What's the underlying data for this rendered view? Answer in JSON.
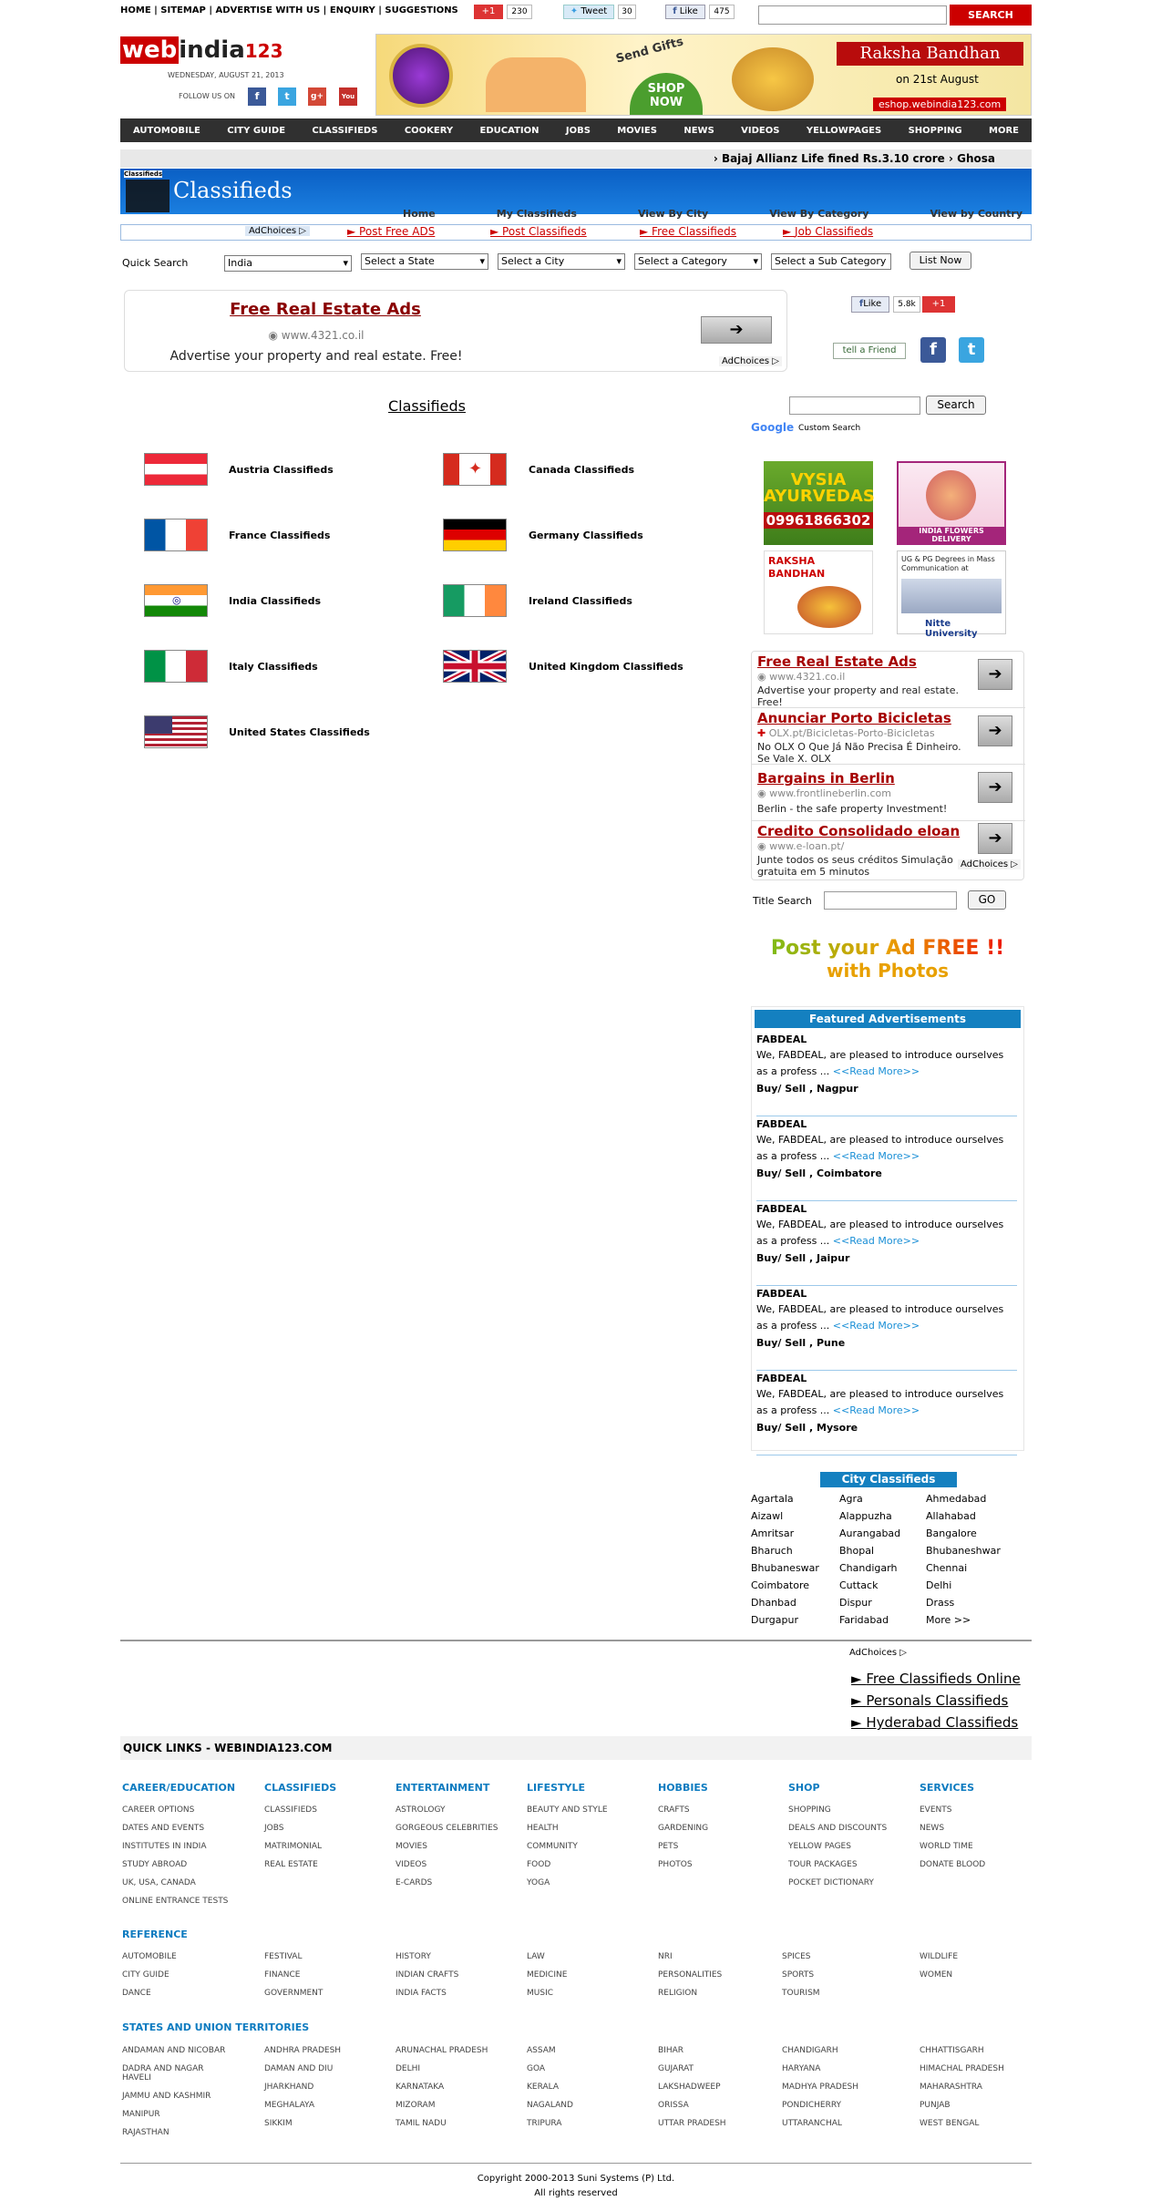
{
  "top": {
    "links": [
      "HOME",
      "SITEMAP",
      "ADVERTISE WITH US",
      "ENQUIRY",
      "SUGGESTIONS"
    ],
    "gplus_label": "+1",
    "gplus_count": "230",
    "tweet_label": "Tweet",
    "tweet_count": "30",
    "fb_label": "Like",
    "fb_count": "475",
    "search_button": "SEARCH",
    "search_value": ""
  },
  "brand": {
    "logo_web": "web",
    "logo_india": "india",
    "logo_num": "123",
    "date": "WEDNESDAY, AUGUST 21, 2013",
    "follow": "FOLLOW US ON"
  },
  "banner": {
    "send_gifts": "Send Gifts",
    "shop_now": "SHOP NOW",
    "title": "Raksha Bandhan",
    "date": "on 21st August",
    "url": "eshop.webindia123.com"
  },
  "nav": [
    "AUTOMOBILE",
    "CITY GUIDE",
    "CLASSIFIEDS",
    "COOKERY",
    "EDUCATION",
    "JOBS",
    "MOVIES",
    "NEWS",
    "VIDEOS",
    "YELLOWPAGES",
    "SHOPPING",
    "MORE"
  ],
  "ticker": "Bajaj Allianz Life fined Rs.3.10 crore  ›  Ghosa",
  "classifieds_banner": {
    "small": "Classifieds",
    "big": "Classifieds"
  },
  "subnav": [
    "Home",
    "My Classifieds",
    "View By City",
    "View By Category",
    "View by Country"
  ],
  "adlinks": {
    "adchoices": "AdChoices",
    "items": [
      "Post Free ADS",
      "Post Classifieds",
      "Free Classifieds",
      "Job Classifieds"
    ]
  },
  "quick_search": {
    "label": "Quick Search",
    "country": "India",
    "state": "Select a State",
    "city": "Select a City",
    "category": "Select a Category",
    "subcategory": "Select a Sub Category",
    "button": "List Now"
  },
  "top_ad": {
    "title": "Free Real Estate Ads",
    "url": "www.4321.co.il",
    "desc": "Advertise your property and real estate. Free!",
    "adchoices": "AdChoices"
  },
  "social": {
    "fb_like": "Like",
    "fb_count": "5.8k",
    "gplus": "+1",
    "tell": "tell a Friend"
  },
  "main_title": "Classifieds",
  "countries": [
    {
      "name": "Austria Classifieds"
    },
    {
      "name": "Canada Classifieds"
    },
    {
      "name": "France Classifieds"
    },
    {
      "name": "Germany Classifieds"
    },
    {
      "name": "India Classifieds"
    },
    {
      "name": "Ireland Classifieds"
    },
    {
      "name": "Italy Classifieds"
    },
    {
      "name": "United Kingdom Classifieds"
    },
    {
      "name": "United States Classifieds"
    }
  ],
  "google_search": {
    "button": "Search",
    "custom": "Custom Search",
    "google": "Google"
  },
  "side_ads": {
    "vysia": "VYSIA AYURVEDAS",
    "vysia_phone": "09961866302",
    "flowers": "INDIA FLOWERS DELIVERY",
    "raksha": "RAKSHA BANDHAN",
    "nitte_text": "UG & PG Degrees in Mass Communication at",
    "nitte": "Nitte University"
  },
  "text_ads": [
    {
      "title": "Free Real Estate Ads",
      "url": "www.4321.co.il",
      "desc": "Advertise your property and real estate. Free!"
    },
    {
      "title": "Anunciar Porto Bicicletas",
      "url": "OLX.pt/Bicicletas-Porto-Bicicletas",
      "desc": "No OLX O Que Já Não Precisa É Dinheiro. Se Vale X. OLX"
    },
    {
      "title": "Bargains in Berlin",
      "url": "www.frontlineberlin.com",
      "desc": "Berlin - the safe property Investment!"
    },
    {
      "title": "Credito Consolidado eloan",
      "url": "www.e-loan.pt/",
      "desc": "Junte todos os seus créditos Simulação gratuita em 5 minutos"
    }
  ],
  "text_ads_adchoices": "AdChoices",
  "title_search": {
    "label": "Title Search",
    "button": "GO"
  },
  "post_ad": {
    "line1": "Post your Ad FREE !!",
    "line2": "with Photos"
  },
  "featured": {
    "header": "Featured Advertisements",
    "items": [
      {
        "title": "FABDEAL",
        "text": "We, FABDEAL, are pleased to introduce ourselves as a profess ...",
        "more": "<<Read More>>",
        "loc": "Buy/ Sell , Nagpur"
      },
      {
        "title": "FABDEAL",
        "text": "We, FABDEAL, are pleased to introduce ourselves as a profess ...",
        "more": "<<Read More>>",
        "loc": "Buy/ Sell , Coimbatore"
      },
      {
        "title": "FABDEAL",
        "text": "We, FABDEAL, are pleased to introduce ourselves as a profess ...",
        "more": "<<Read More>>",
        "loc": "Buy/ Sell , Jaipur"
      },
      {
        "title": "FABDEAL",
        "text": "We, FABDEAL, are pleased to introduce ourselves as a profess ...",
        "more": "<<Read More>>",
        "loc": "Buy/ Sell , Pune"
      },
      {
        "title": "FABDEAL",
        "text": "We, FABDEAL, are pleased to introduce ourselves as a profess ...",
        "more": "<<Read More>>",
        "loc": "Buy/ Sell , Mysore"
      }
    ]
  },
  "city_classifieds": {
    "header": "City Classifieds",
    "cities": [
      "Agartala",
      "Agra",
      "Ahmedabad",
      "Aizawl",
      "Alappuzha",
      "Allahabad",
      "Amritsar",
      "Aurangabad",
      "Bangalore",
      "Bharuch",
      "Bhopal",
      "Bhubaneshwar",
      "Bhubaneswar",
      "Chandigarh",
      "Chennai",
      "Coimbatore",
      "Cuttack",
      "Delhi",
      "Dhanbad",
      "Dispur",
      "Drass",
      "Durgapur",
      "Faridabad",
      "More >>"
    ]
  },
  "bottom_ads": {
    "adchoices": "AdChoices",
    "items": [
      "Free Classifieds Online",
      "Personals Classifieds",
      "Hyderabad Classifieds"
    ]
  },
  "quicklinks": {
    "title": "QUICK LINKS - WEBINDIA123.COM",
    "cols": [
      {
        "h": "CAREER/EDUCATION",
        "items": [
          "CAREER OPTIONS",
          "DATES AND EVENTS",
          "INSTITUTES IN INDIA",
          "STUDY ABROAD",
          "UK, USA, CANADA",
          "ONLINE ENTRANCE TESTS"
        ]
      },
      {
        "h": "CLASSIFIEDS",
        "items": [
          "CLASSIFIEDS",
          "JOBS",
          "MATRIMONIAL",
          "REAL ESTATE"
        ]
      },
      {
        "h": "ENTERTAINMENT",
        "items": [
          "ASTROLOGY",
          "GORGEOUS CELEBRITIES",
          "MOVIES",
          "VIDEOS",
          "E-CARDS"
        ]
      },
      {
        "h": "LIFESTYLE",
        "items": [
          "BEAUTY AND STYLE",
          "HEALTH",
          "COMMUNITY",
          "FOOD",
          "YOGA"
        ]
      },
      {
        "h": "HOBBIES",
        "items": [
          "CRAFTS",
          "GARDENING",
          "PETS",
          "PHOTOS"
        ]
      },
      {
        "h": "SHOP",
        "items": [
          "SHOPPING",
          "DEALS AND DISCOUNTS",
          "YELLOW PAGES",
          "TOUR PACKAGES",
          "POCKET DICTIONARY"
        ]
      },
      {
        "h": "SERVICES",
        "items": [
          "EVENTS",
          "NEWS",
          "WORLD TIME",
          "DONATE BLOOD"
        ]
      }
    ],
    "reference_h": "REFERENCE",
    "reference": [
      [
        "AUTOMOBILE",
        "CITY GUIDE",
        "DANCE"
      ],
      [
        "FESTIVAL",
        "FINANCE",
        "GOVERNMENT"
      ],
      [
        "HISTORY",
        "INDIAN CRAFTS",
        "INDIA FACTS"
      ],
      [
        "LAW",
        "MEDICINE",
        "MUSIC"
      ],
      [
        "NRI",
        "PERSONALITIES",
        "RELIGION"
      ],
      [
        "SPICES",
        "SPORTS",
        "TOURISM"
      ],
      [
        "WILDLIFE",
        "WOMEN"
      ]
    ],
    "states_h": "STATES AND UNION TERRITORIES",
    "states": [
      [
        "ANDAMAN AND NICOBAR",
        "DADRA AND NAGAR HAVELI",
        "JAMMU AND KASHMIR",
        "MANIPUR",
        "RAJASTHAN"
      ],
      [
        "ANDHRA PRADESH",
        "DAMAN AND DIU",
        "JHARKHAND",
        "MEGHALAYA",
        "SIKKIM"
      ],
      [
        "ARUNACHAL PRADESH",
        "DELHI",
        "KARNATAKA",
        "MIZORAM",
        "TAMIL NADU"
      ],
      [
        "ASSAM",
        "GOA",
        "KERALA",
        "NAGALAND",
        "TRIPURA"
      ],
      [
        "BIHAR",
        "GUJARAT",
        "LAKSHADWEEP",
        "ORISSA",
        "UTTAR PRADESH"
      ],
      [
        "CHANDIGARH",
        "HARYANA",
        "MADHYA PRADESH",
        "PONDICHERRY",
        "UTTARANCHAL"
      ],
      [
        "CHHATTISGARH",
        "HIMACHAL PRADESH",
        "MAHARASHTRA",
        "PUNJAB",
        "WEST BENGAL"
      ]
    ]
  },
  "footer": {
    "copyright": "Copyright 2000-2013 Suni Systems (P) Ltd.",
    "rights": "All rights reserved"
  }
}
